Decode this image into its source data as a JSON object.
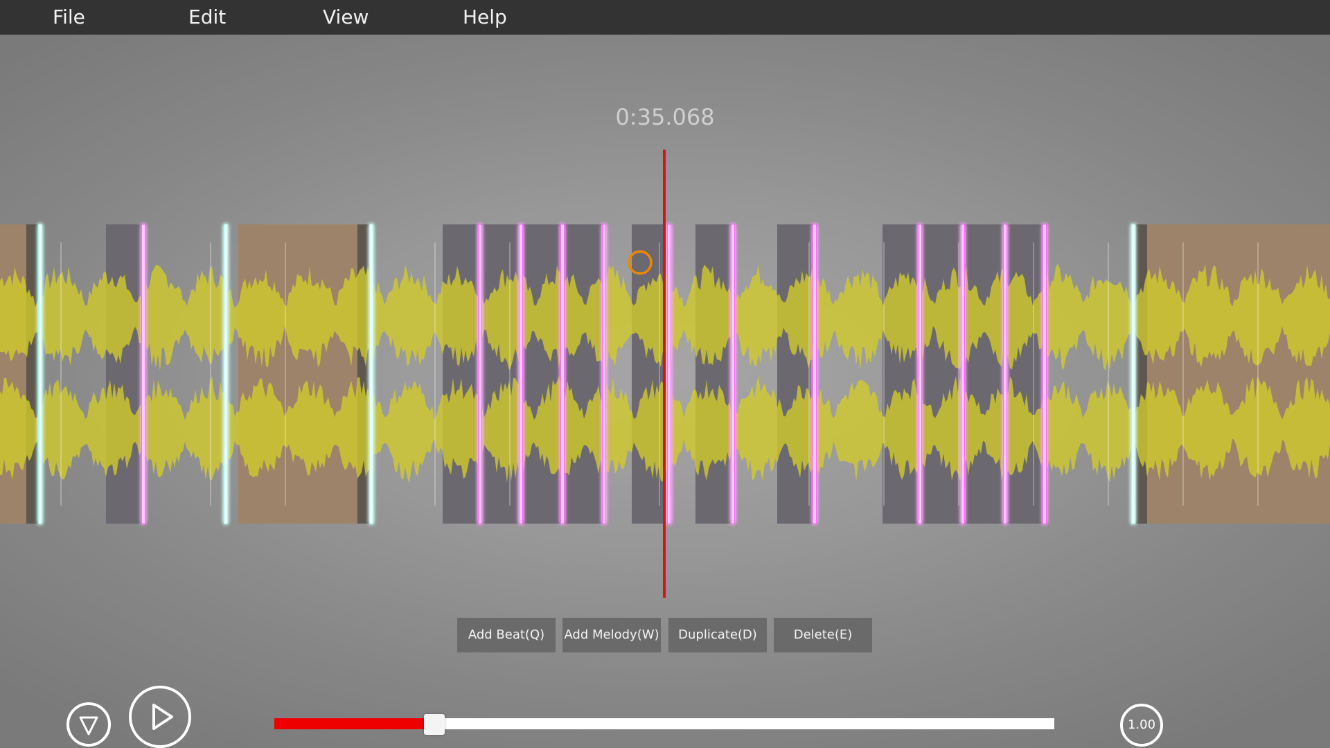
{
  "menu": {
    "items": [
      {
        "id": "file",
        "label": "File"
      },
      {
        "id": "edit",
        "label": "Edit"
      },
      {
        "id": "view",
        "label": "View"
      },
      {
        "id": "help",
        "label": "Help"
      }
    ]
  },
  "timeline": {
    "current_time": "0:35.068"
  },
  "toolbar": {
    "add_beat_label": "Add Beat(Q)",
    "add_melody_label": "Add Melody(W)",
    "duplicate_label": "Duplicate(D)",
    "delete_label": "Delete(E)"
  },
  "playback": {
    "speed_label": "1.00",
    "progress_fraction": 0.205
  },
  "icons": {
    "filter": "triangle-down-icon",
    "play": "play-icon"
  },
  "colors": {
    "menubar_bg": "#333333",
    "waveform": "#d4cc2a",
    "beat_marker": "#ff66ff",
    "melody_marker": "#aef7ee",
    "playhead": "#dd1111",
    "cursor_ring": "#ee8800",
    "progress_fill": "#ee0000"
  }
}
